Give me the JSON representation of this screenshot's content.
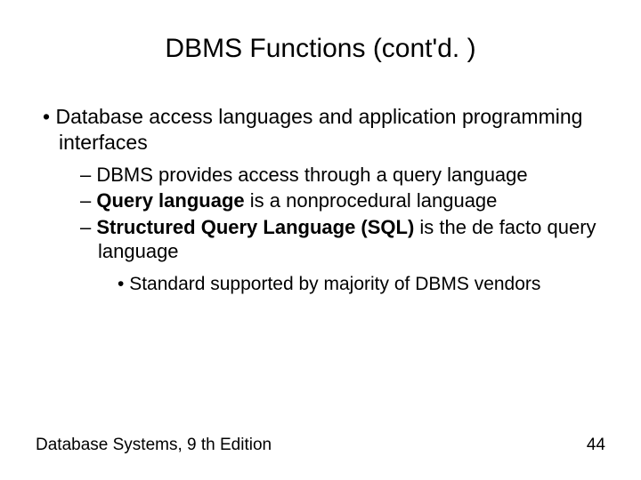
{
  "title": "DBMS Functions (cont'd. )",
  "bullets": {
    "l1_0": "Database access languages and application programming interfaces",
    "l2_0": "DBMS provides access through a query language",
    "l2_1_bold": "Query language",
    "l2_1_rest": " is a nonprocedural language",
    "l2_2_bold": "Structured Query Language (SQL)",
    "l2_2_rest": " is the de facto query language",
    "l3_0": "Standard supported by majority of DBMS vendors"
  },
  "footer": {
    "left": "Database Systems, 9 th Edition",
    "right": "44"
  }
}
